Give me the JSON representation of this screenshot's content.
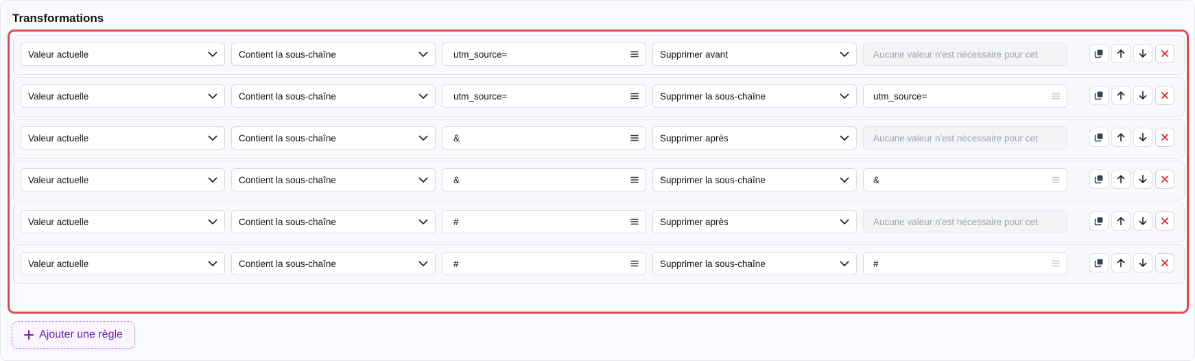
{
  "section": {
    "title": "Transformations"
  },
  "rules": [
    {
      "source": "Valeur actuelle",
      "condition": "Contient la sous-chaîne",
      "pattern": "utm_source=",
      "action": "Supprimer avant",
      "value": "",
      "value_placeholder": "Aucune valeur n'est nécessaire pour cet",
      "value_disabled": true
    },
    {
      "source": "Valeur actuelle",
      "condition": "Contient la sous-chaîne",
      "pattern": "utm_source=",
      "action": "Supprimer la sous-chaîne",
      "value": "utm_source=",
      "value_placeholder": "",
      "value_disabled": false
    },
    {
      "source": "Valeur actuelle",
      "condition": "Contient la sous-chaîne",
      "pattern": "&",
      "action": "Supprimer après",
      "value": "",
      "value_placeholder": "Aucune valeur n'est nécessaire pour cet",
      "value_disabled": true
    },
    {
      "source": "Valeur actuelle",
      "condition": "Contient la sous-chaîne",
      "pattern": "&",
      "action": "Supprimer la sous-chaîne",
      "value": "&",
      "value_placeholder": "",
      "value_disabled": false
    },
    {
      "source": "Valeur actuelle",
      "condition": "Contient la sous-chaîne",
      "pattern": "#",
      "action": "Supprimer après",
      "value": "",
      "value_placeholder": "Aucune valeur n'est nécessaire pour cet",
      "value_disabled": true
    },
    {
      "source": "Valeur actuelle",
      "condition": "Contient la sous-chaîne",
      "pattern": "#",
      "action": "Supprimer la sous-chaîne",
      "value": "#",
      "value_placeholder": "",
      "value_disabled": false
    }
  ],
  "row_actions": {
    "icons": [
      "copy-icon",
      "arrow-up-icon",
      "arrow-down-icon",
      "close-icon"
    ]
  },
  "add_rule": {
    "label": "Ajouter une règle",
    "icon": "plus-icon"
  },
  "colors": {
    "highlight_border": "#dc4b4b",
    "accent": "#6b21a8",
    "delete": "#dc2626"
  }
}
